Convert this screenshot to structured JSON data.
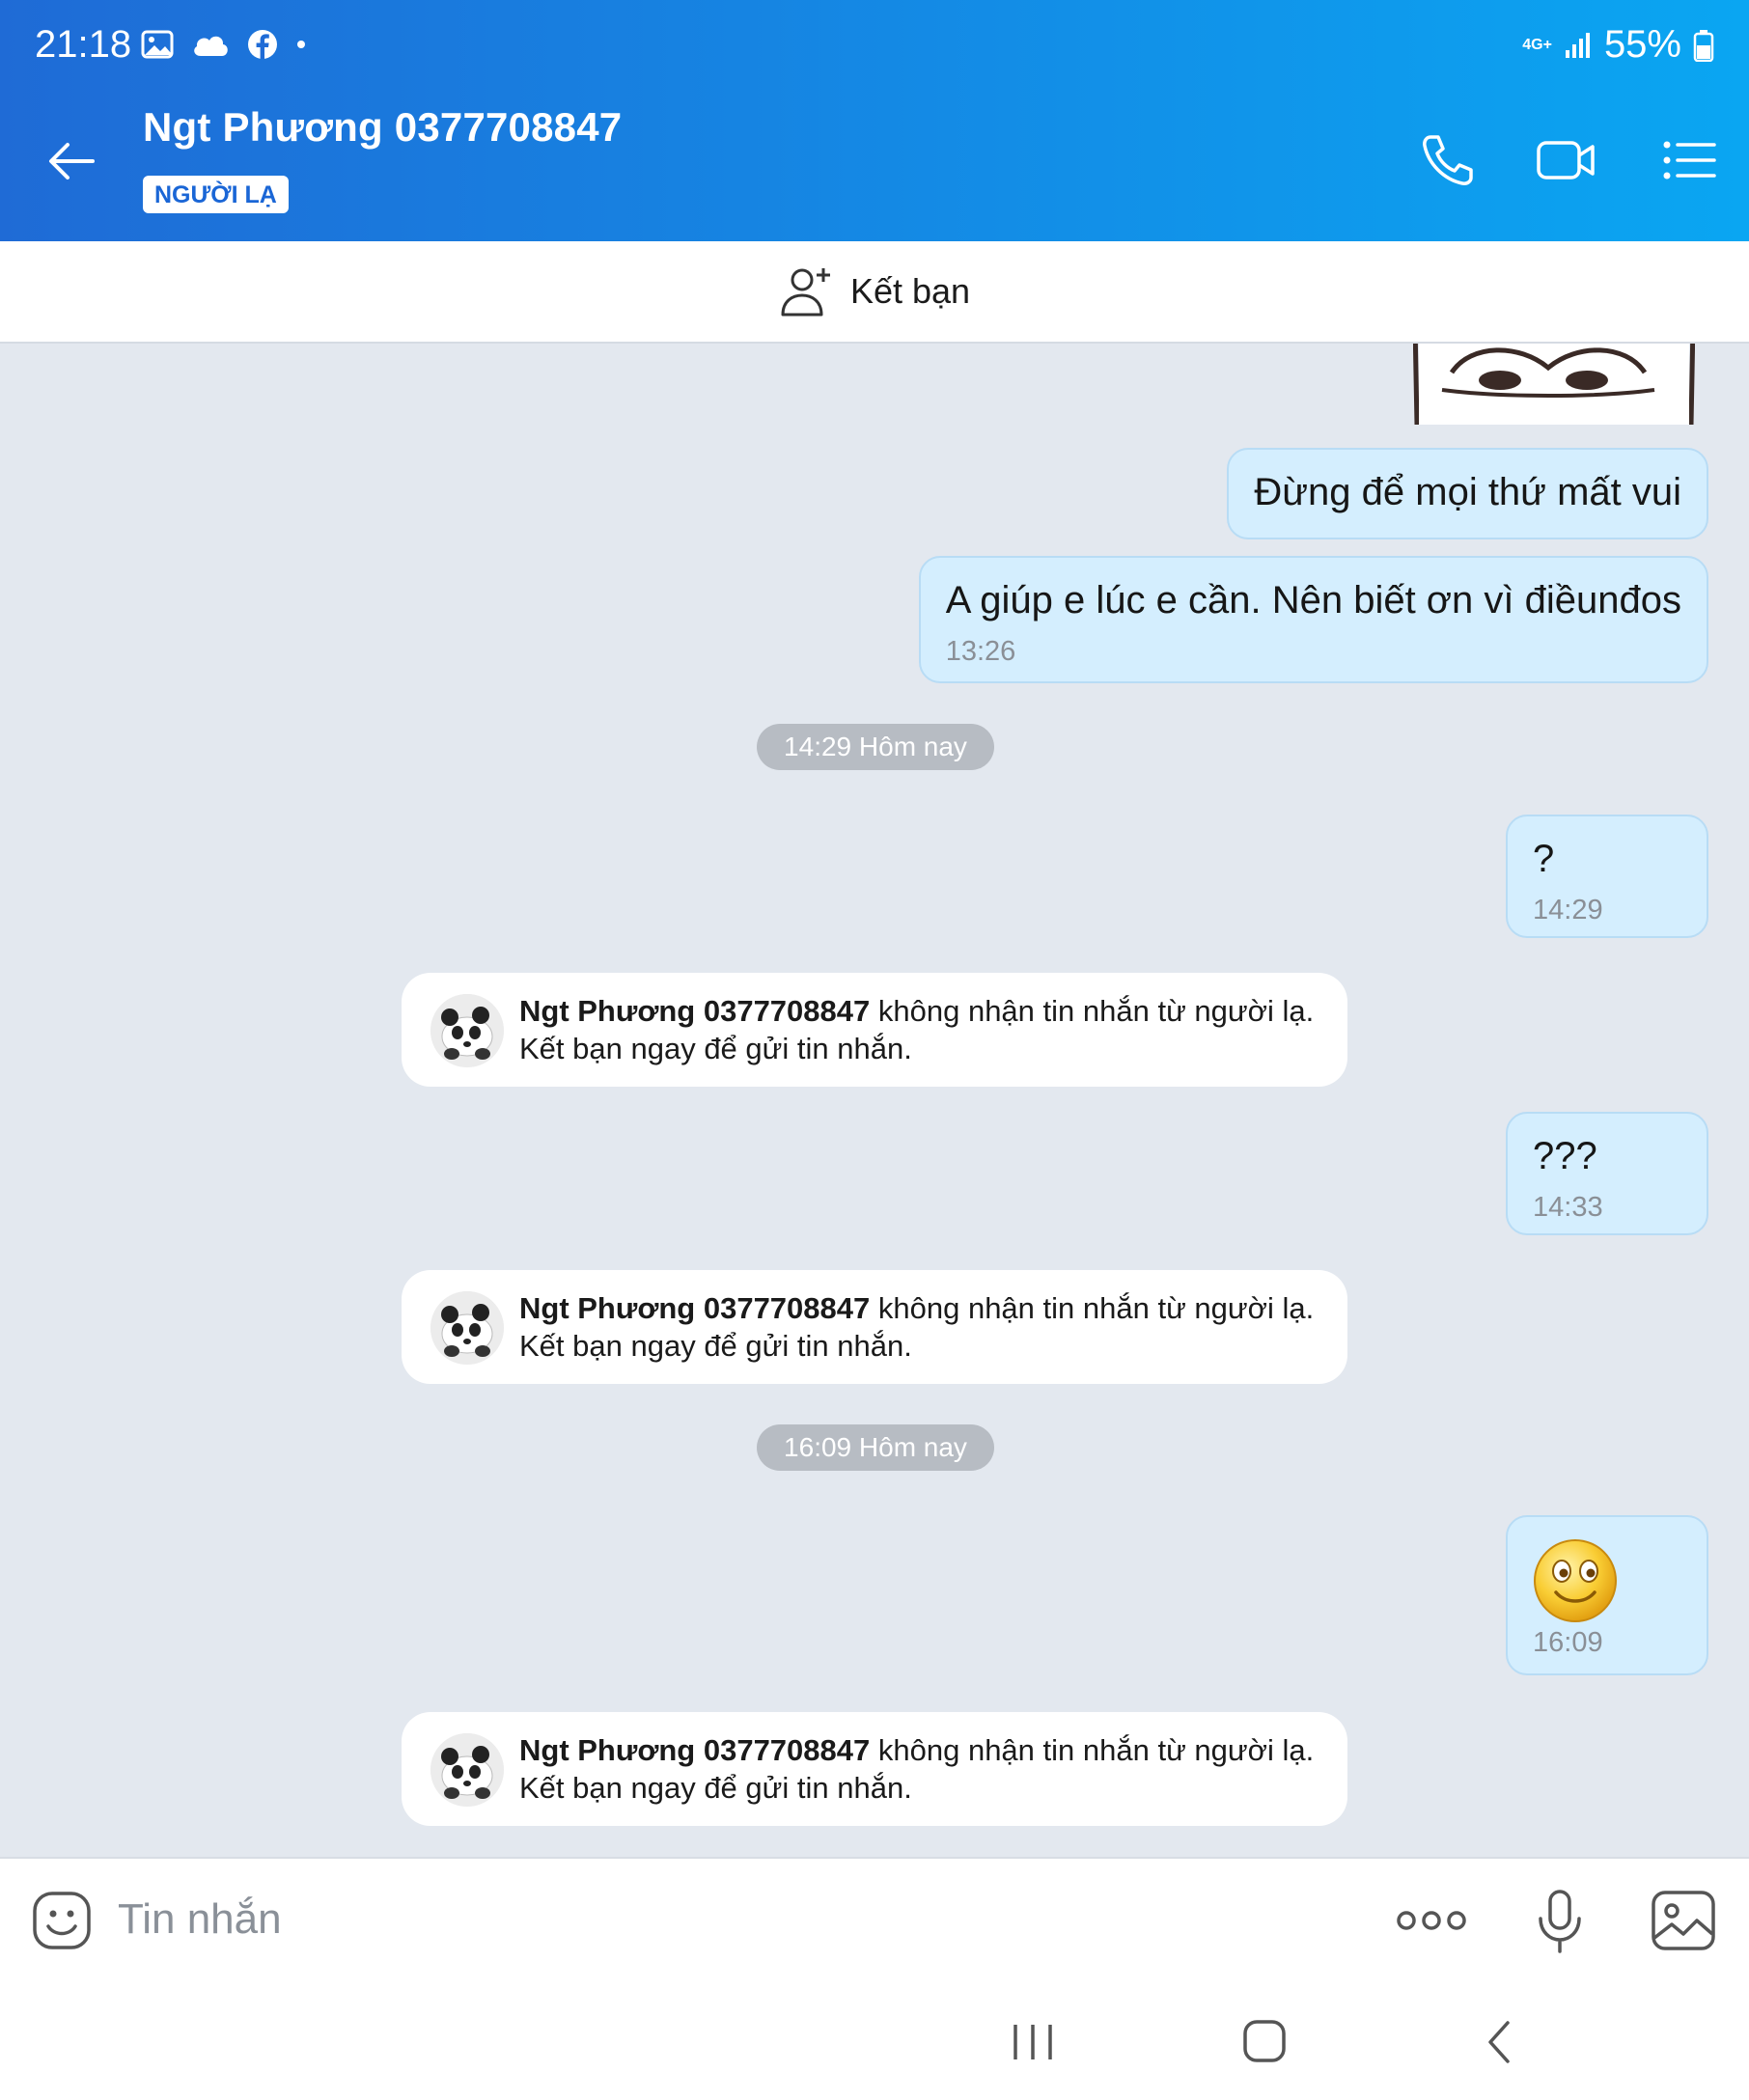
{
  "status_bar": {
    "time": "21:18",
    "network": "4G+",
    "battery": "55%",
    "icons": [
      "gallery-icon",
      "cloud-icon",
      "facebook-icon",
      "dot-icon"
    ]
  },
  "header": {
    "title": "Ngt Phương 0377708847",
    "badge": "NGƯỜI LẠ",
    "actions": [
      "phone-icon",
      "video-icon",
      "menu-list-icon"
    ]
  },
  "friend_bar": {
    "label": "Kết bạn"
  },
  "messages": {
    "m1": {
      "text": "Đừng để mọi thứ mất vui"
    },
    "m2": {
      "text": "A giúp e lúc e cần. Nên biết ơn vì điềunđos",
      "time": "13:26"
    },
    "sep1": "14:29 Hôm nay",
    "m3": {
      "text": "?",
      "time": "14:29"
    },
    "sys1": {
      "name": "Ngt Phương 0377708847",
      "line1": " không nhận tin nhắn từ người lạ.",
      "line2": "Kết bạn ngay để gửi tin nhắn."
    },
    "m4": {
      "text": "???",
      "time": "14:33"
    },
    "sys2": {
      "name": "Ngt Phương 0377708847",
      "line1": " không nhận tin nhắn từ người lạ.",
      "line2": "Kết bạn ngay để gửi tin nhắn."
    },
    "sep2": "16:09 Hôm nay",
    "m5": {
      "time": "16:09"
    },
    "sys3": {
      "name": "Ngt Phương 0377708847",
      "line1": " không nhận tin nhắn từ người lạ.",
      "line2": "Kết bạn ngay để gửi tin nhắn."
    }
  },
  "composer": {
    "placeholder": "Tin nhắn"
  },
  "colors": {
    "header_start": "#1f6bd6",
    "header_end": "#0aa6f2",
    "outgoing_bubble": "#d4eefe",
    "chat_bg": "#e3e8ef"
  }
}
